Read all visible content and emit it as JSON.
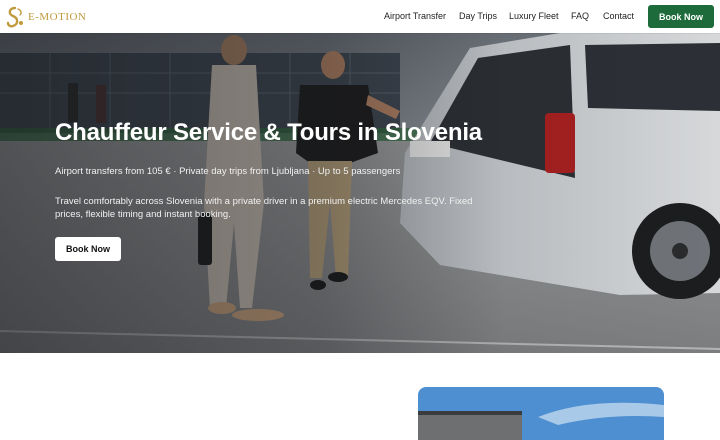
{
  "brand": {
    "name": "E-MOTION",
    "accent": "#c09a3c"
  },
  "nav": {
    "links": [
      "Airport Transfer",
      "Day Trips",
      "Luxury Fleet",
      "FAQ",
      "Contact"
    ],
    "cta": "Book Now",
    "cta_color": "#1d6b3a"
  },
  "hero": {
    "title": "Chauffeur Service & Tours in Slovenia",
    "subtitle": "Airport transfers from 105 € · Private day trips from Ljubljana · Up to 5 passengers",
    "description": "Travel comfortably across Slovenia with a private driver in a premium electric Mercedes EQV. Fixed prices, flexible timing and instant booking.",
    "cta": "Book Now"
  }
}
